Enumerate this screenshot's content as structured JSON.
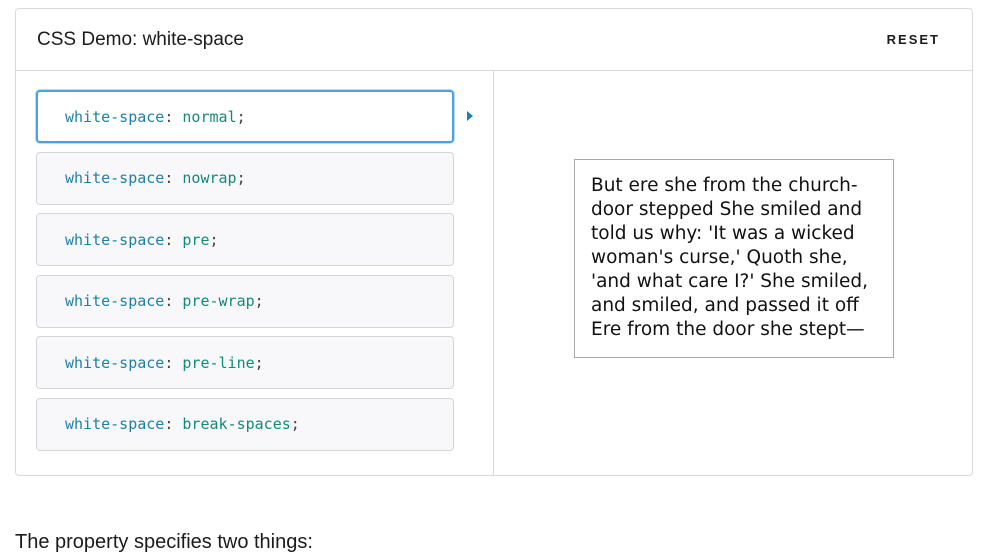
{
  "demo": {
    "title": "CSS Demo: white-space",
    "reset_label": "RESET"
  },
  "choices": [
    {
      "property": "white-space",
      "value": "normal",
      "selected": true
    },
    {
      "property": "white-space",
      "value": "nowrap",
      "selected": false
    },
    {
      "property": "white-space",
      "value": "pre",
      "selected": false
    },
    {
      "property": "white-space",
      "value": "pre-wrap",
      "selected": false
    },
    {
      "property": "white-space",
      "value": "pre-line",
      "selected": false
    },
    {
      "property": "white-space",
      "value": "break-spaces",
      "selected": false
    }
  ],
  "output": {
    "text": "But ere she from the church-door stepped She smiled and told us why: 'It was a wicked woman's curse,' Quoth she, 'and what care I?' She smiled, and smiled, and passed it off Ere from the door she stept—"
  },
  "page": {
    "below_text": "The property specifies two things:"
  },
  "colors": {
    "selected_border": "#4aa3df",
    "property_color": "#1e7fa8",
    "value_color": "#14897a"
  }
}
